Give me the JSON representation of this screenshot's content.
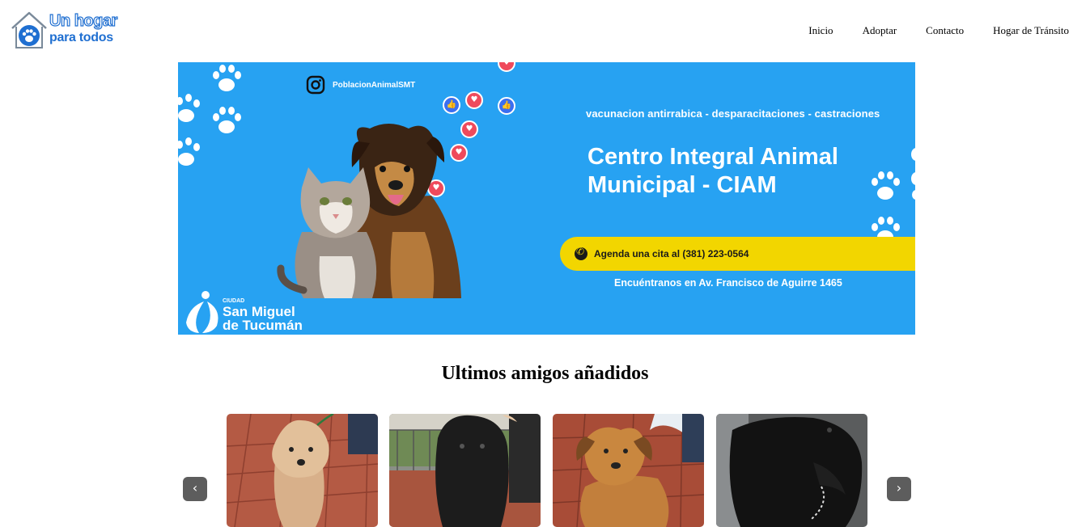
{
  "header": {
    "logo_line1": "Un hogar",
    "logo_line2": "para todos",
    "nav": [
      "Inicio",
      "Adoptar",
      "Contacto",
      "Hogar de Tránsito"
    ]
  },
  "banner": {
    "instagram": "PoblacionAnimalSMT",
    "services": "vacunacion antirrabica - desparacitaciones   - castraciones",
    "title_line1": "Centro Integral Animal",
    "title_line2": "Municipal - CIAM",
    "cita": "Agenda una cita al (381) 223-0564",
    "address": "Encuéntranos en Av. Francisco de Aguirre 1465",
    "city_small": "CIUDAD",
    "city_line1": "San Miguel",
    "city_line2": "de Tucumán"
  },
  "section": {
    "title": "Ultimos amigos añadidos"
  },
  "carousel": {
    "prev": "‹",
    "next": "›",
    "cards": [
      "tan-terrier-dog",
      "black-curly-dog",
      "tan-mixed-dog",
      "black-dog"
    ]
  },
  "colors": {
    "brand_blue": "#1f6fd1",
    "banner_blue": "#27a2f2",
    "banner_yellow": "#f2d600",
    "button_gray": "#5d5d5d"
  }
}
